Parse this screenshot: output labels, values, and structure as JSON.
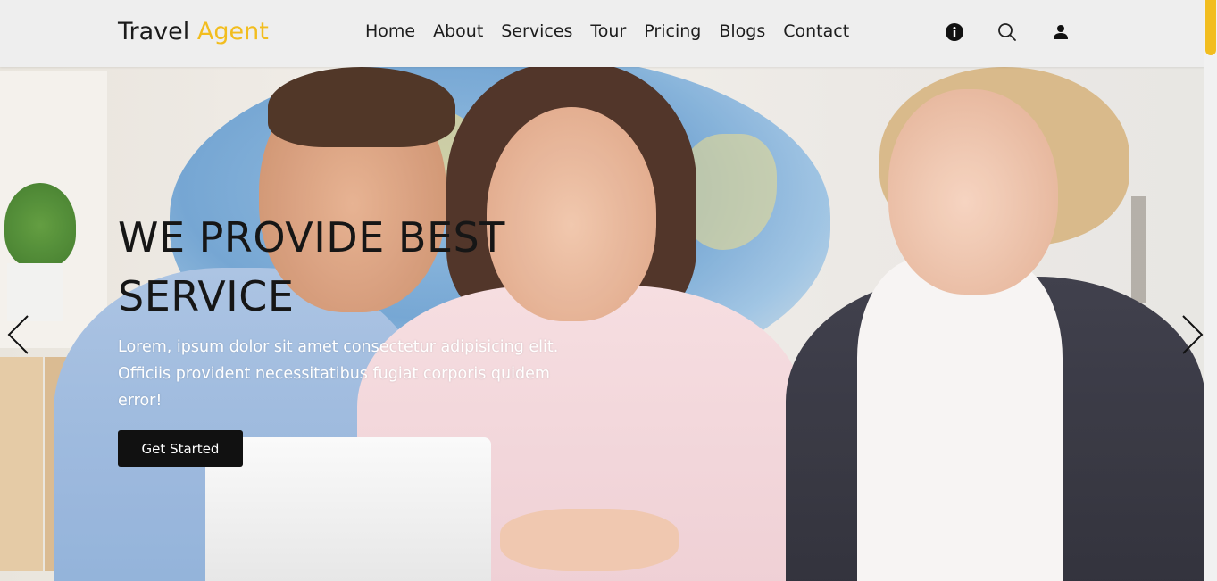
{
  "header": {
    "brand_main": "Travel",
    "brand_accent": "Agent",
    "nav": [
      "Home",
      "About",
      "Services",
      "Tour",
      "Pricing",
      "Blogs",
      "Contact"
    ],
    "icons": [
      "info-icon",
      "search-icon",
      "user-icon"
    ]
  },
  "hero": {
    "title_line1": "WE PROVIDE BEST",
    "title_line2": "SERVICE",
    "text": "Lorem, ipsum dolor sit amet consectetur adipisicing elit. Officiis provident necessitatibus fugiat corporis quidem error!",
    "cta_label": "Get Started",
    "prev_icon": "chevron-left-icon",
    "next_icon": "chevron-right-icon"
  },
  "colors": {
    "accent": "#f2bd1e",
    "header_bg": "#eeeeee",
    "button_bg": "#111111"
  }
}
